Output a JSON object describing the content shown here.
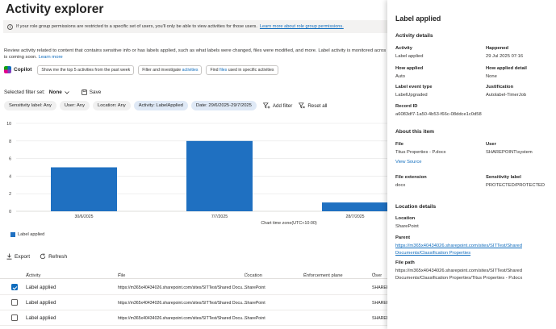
{
  "page": {
    "title": "Activity explorer",
    "info_text": "If your role group permissions are restricted to a specific set of users, you'll only be able to view activities for those users.",
    "info_link": "Learn more about role group permissions.",
    "description": "Review activity related to content that contains sensitive info or has labels applied, such as what labels were changed, files were modified, and more. Label activity is monitored acros",
    "description_line2": "is coming soon.",
    "description_link": "Learn more"
  },
  "copilot": {
    "label": "Copilot",
    "prompts": [
      {
        "text": "Show me the top 5 activities from the past week",
        "highlight": ""
      },
      {
        "pre": "Filter and investigate ",
        "highlight": "activities"
      },
      {
        "pre": "Find ",
        "highlight": "files",
        "post": " used in specific activities"
      }
    ]
  },
  "filterset": {
    "label": "Selected filter set:",
    "value": "None",
    "save": "Save"
  },
  "filters": [
    {
      "text": "Sensitivity label: Any",
      "active": false
    },
    {
      "text": "User: Any",
      "active": false
    },
    {
      "text": "Location: Any",
      "active": false
    },
    {
      "text": "Activity: LabelApplied",
      "active": true
    },
    {
      "text": "Date: 29/6/2025-29/7/2025",
      "active": true
    }
  ],
  "filter_actions": {
    "add": "Add filter",
    "reset": "Reset all"
  },
  "chart_data": {
    "type": "bar",
    "categories": [
      "30/6/2025",
      "7/7/2025",
      "28/7/2025"
    ],
    "series": [
      {
        "name": "Label applied",
        "values": [
          5,
          8,
          1
        ],
        "color": "#1f70c1"
      }
    ],
    "xlabel": "Chart time zone(UTC+10:00)",
    "ylabel": "",
    "ylim": [
      0,
      10
    ],
    "yticks": [
      "0",
      "2",
      "4",
      "6",
      "8",
      "10"
    ],
    "grid": true,
    "legend": "bottom-left"
  },
  "table_actions": {
    "export": "Export",
    "refresh": "Refresh"
  },
  "table": {
    "columns": [
      "Activity",
      "File",
      "Location",
      "Enforcement plane",
      "User"
    ],
    "rows": [
      {
        "checked": true,
        "activity": "Label applied",
        "file": "https://m365x40434026.sharepoint.com/sites/SITTest/Shared Docu...",
        "location": "SharePoint",
        "user": "SHAREPO"
      },
      {
        "checked": false,
        "activity": "Label applied",
        "file": "https://m365x40434026.sharepoint.com/sites/SITTest/Shared Docu...",
        "location": "SharePoint",
        "user": "SHAREPO"
      },
      {
        "checked": false,
        "activity": "Label applied",
        "file": "https://m365x40434026.sharepoint.com/sites/SITTest/Shared Docu...",
        "location": "SharePoint",
        "user": "SHAREP"
      }
    ]
  },
  "panel": {
    "title": "Label applied",
    "activity_details": {
      "heading": "Activity details",
      "activity_label": "Activity",
      "activity_value": "Label applied",
      "happened_label": "Happened",
      "happened_value": "29 Jul 2025 07:16",
      "how_applied_label": "How applied",
      "how_applied_value": "Auto",
      "how_applied_detail_label": "How applied detail",
      "how_applied_detail_value": "None",
      "label_event_type_label": "Label event type",
      "label_event_type_value": "LabelUpgraded",
      "justification_label": "Justification",
      "justification_value": "Autolabel-TimerJob",
      "record_id_label": "Record ID",
      "record_id_value": "a6083df7-1a50-4b53-f66c-08ddce1c0d58"
    },
    "about_item": {
      "heading": "About this item",
      "file_label": "File",
      "file_value": "Titus Properties - P.docx",
      "user_label": "User",
      "user_value": "SHAREPOINT\\system",
      "view_source": "View Source",
      "file_ext_label": "File extension",
      "file_ext_value": "docx",
      "sensitivity_label": "Sensitivity label",
      "sensitivity_value": "PROTECTED/PROTECTED"
    },
    "location_details": {
      "heading": "Location details",
      "location_label": "Location",
      "location_value": "SharePoint",
      "parent_label": "Parent",
      "parent_value": "https://m365x40434026.sharepoint.com/sites/SITTest/Shared Documents/Classification Properties",
      "filepath_label": "File path",
      "filepath_value": "https://m365x40434026.sharepoint.com/sites/SITTest/Shared Documents/Classification Properties/Titus Properties - P.docx"
    }
  },
  "colors": {
    "accent": "#0f6cbd",
    "bar": "#1f70c1"
  }
}
